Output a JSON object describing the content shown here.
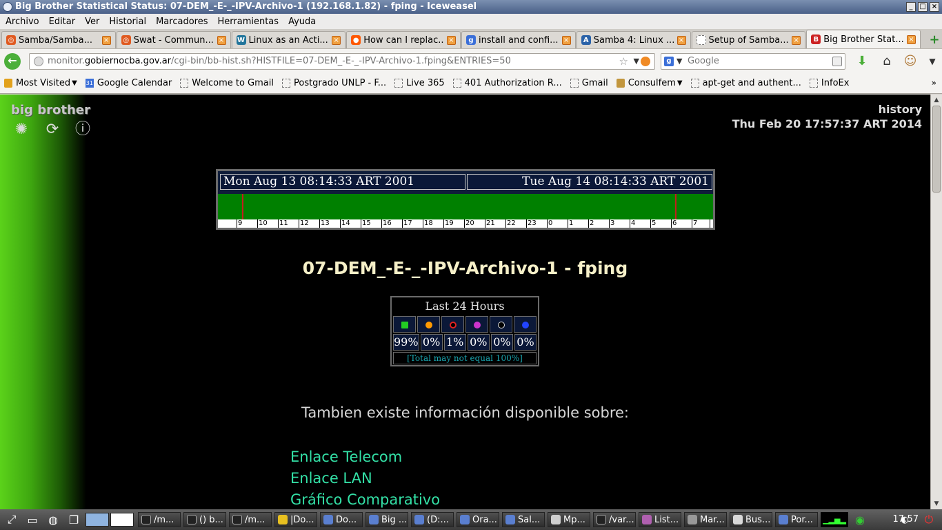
{
  "window": {
    "title": "Big Brother Statistical Status: 07-DEM_-E-_-IPV-Archivo-1 (192.168.1.82) - fping - Iceweasel"
  },
  "menu": [
    "Archivo",
    "Editar",
    "Ver",
    "Historial",
    "Marcadores",
    "Herramientas",
    "Ayuda"
  ],
  "tabs": [
    {
      "label": "Samba/Samba...",
      "icon": "ubuntu-icon",
      "color": "#e05a20"
    },
    {
      "label": "Swat - Commun...",
      "icon": "ubuntu-icon",
      "color": "#e05a20"
    },
    {
      "label": "Linux as an Acti...",
      "icon": "wordpress-icon",
      "color": "#21759b"
    },
    {
      "label": "How can I replac...",
      "icon": "reddit-icon",
      "color": "#ff5700"
    },
    {
      "label": "install and confi...",
      "icon": "google-icon",
      "color": "#3b6fd8"
    },
    {
      "label": "Samba 4: Linux ...",
      "icon": "site-icon",
      "color": "#2a62a8"
    },
    {
      "label": "Setup of Samba...",
      "icon": "page-icon",
      "color": "#cccccc"
    },
    {
      "label": "Big Brother Stat...",
      "icon": "bb-icon",
      "color": "#cc2222"
    }
  ],
  "nav": {
    "url_prefix": "monitor.",
    "url_host": "gobiernocba.gov.ar",
    "url_path": "/cgi-bin/bb-hist.sh?HISTFILE=07-DEM_-E-_-IPV-Archivo-1.fping&ENTRIES=50",
    "search_placeholder": "Google"
  },
  "bookmarks": [
    {
      "label": "Most Visited",
      "icon": "folder-icon",
      "dropdown": true
    },
    {
      "label": "Google Calendar",
      "icon": "calendar-icon",
      "dropdown": false
    },
    {
      "label": "Welcome to Gmail",
      "icon": "page-icon",
      "dropdown": false
    },
    {
      "label": "Postgrado UNLP - F...",
      "icon": "page-icon",
      "dropdown": false
    },
    {
      "label": "Live 365",
      "icon": "page-icon",
      "dropdown": false
    },
    {
      "label": "401 Authorization R...",
      "icon": "page-icon",
      "dropdown": false
    },
    {
      "label": "Gmail",
      "icon": "page-icon",
      "dropdown": false
    },
    {
      "label": "Consulfem",
      "icon": "kit-icon",
      "dropdown": true
    },
    {
      "label": "apt-get and authent...",
      "icon": "page-icon",
      "dropdown": false
    },
    {
      "label": "InfoEx",
      "icon": "page-icon",
      "dropdown": false
    }
  ],
  "page": {
    "logo": "big brother",
    "history_label": "history",
    "current_date": "Thu Feb 20 17:57:37 ART 2014",
    "timeline": {
      "start": "Mon Aug 13 08:14:33 ART 2001",
      "end": "Tue Aug 14 08:14:33 ART 2001",
      "hours": [
        "9",
        "10",
        "11",
        "12",
        "13",
        "14",
        "15",
        "16",
        "17",
        "18",
        "19",
        "20",
        "21",
        "22",
        "23",
        "0",
        "1",
        "2",
        "3",
        "4",
        "5",
        "6",
        "7"
      ],
      "status_color": "#008000",
      "event_color": "#c41c1c"
    },
    "heading": "07-DEM_-E-_-IPV-Archivo-1 - fping",
    "stats": {
      "title": "Last 24 Hours",
      "columns": [
        {
          "icon": "green-status-icon",
          "color": "#22cc22",
          "pct": "99%"
        },
        {
          "icon": "yellow-status-icon",
          "color": "#ff9900",
          "pct": "0%"
        },
        {
          "icon": "red-status-icon",
          "color": "#dd2222",
          "pct": "1%"
        },
        {
          "icon": "purple-status-icon",
          "color": "#cc33cc",
          "pct": "0%"
        },
        {
          "icon": "clear-status-icon",
          "color": "#dddddd",
          "pct": "0%"
        },
        {
          "icon": "blue-status-icon",
          "color": "#2244ff",
          "pct": "0%"
        }
      ],
      "note": "[Total may not equal 100%]"
    },
    "info_heading": "Tambien existe información disponible sobre:",
    "links": [
      "Enlace Telecom",
      "Enlace LAN",
      "Gráfico Comparativo"
    ]
  },
  "taskbar": {
    "tasks": [
      "/m...",
      "() b...",
      "/m...",
      "|Do...",
      "Do...",
      "Big ...",
      "(D:...",
      "Ora...",
      "Sal...",
      "Mp...",
      "/var...",
      "List...",
      "Mar...",
      "Bus...",
      "Por..."
    ],
    "clock": "17:57"
  }
}
